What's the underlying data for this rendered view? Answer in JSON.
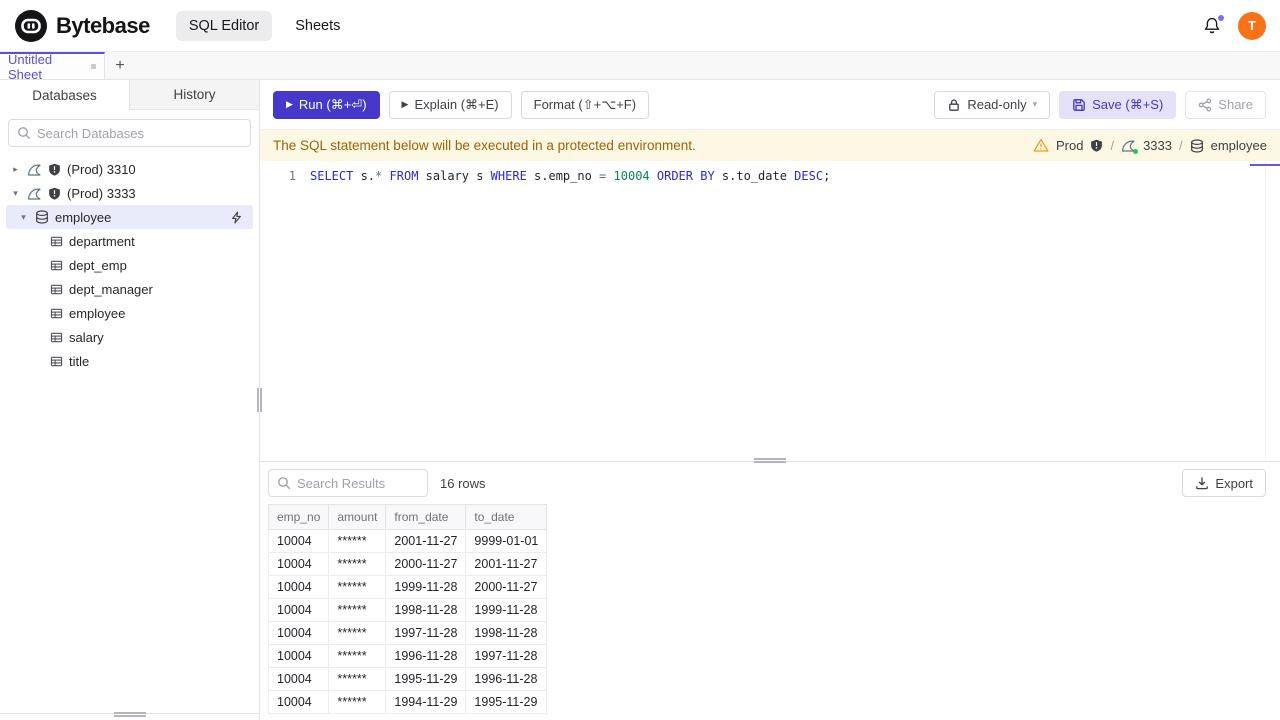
{
  "colors": {
    "accent": "#4538ca",
    "accent_light_bg": "#e4e1f9",
    "banner_bg": "#fcf8e3",
    "banner_text": "#a16207",
    "avatar_bg": "#f97316",
    "notification_dot": "#7a6ff0",
    "connection_status_dot": "#22c55e",
    "sql_keyword": "#2a2ad4",
    "sql_number": "#098658",
    "selected_tree_row_bg": "#e9ebfa"
  },
  "header": {
    "brand": "Bytebase",
    "nav_sql_editor": "SQL Editor",
    "nav_sheets": "Sheets",
    "avatar_initial": "T"
  },
  "sheetbar": {
    "active_tab": "Untitled Sheet",
    "add_button": "+"
  },
  "sidebar": {
    "tab_databases": "Databases",
    "tab_history": "History",
    "search_placeholder": "Search Databases",
    "instances": [
      {
        "label": "(Prod) 3310",
        "expanded": false
      },
      {
        "label": "(Prod) 3333",
        "expanded": true
      }
    ],
    "database": "employee",
    "tables": [
      "department",
      "dept_emp",
      "dept_manager",
      "employee",
      "salary",
      "title"
    ],
    "caret_collapsed": "▸",
    "caret_expanded": "▾"
  },
  "toolbar": {
    "run": "Run (⌘+⏎)",
    "explain": "Explain (⌘+E)",
    "format": "Format (⇧+⌥+F)",
    "readonly": "Read-only",
    "save": "Save (⌘+S)",
    "share": "Share",
    "play_glyph": "▶",
    "chevron_glyph": "▾"
  },
  "banner": {
    "message": "The SQL statement below will be executed in a protected environment.",
    "environment": "Prod",
    "separator": "/",
    "instance": "3333",
    "database": "employee"
  },
  "editor": {
    "line_number": "1",
    "sql_text": "SELECT s.* FROM salary s WHERE s.emp_no = 10004 ORDER BY s.to_date DESC;",
    "tokens": [
      {
        "text": "SELECT",
        "type": "keyword"
      },
      {
        "text": " s.",
        "type": "plain"
      },
      {
        "text": "*",
        "type": "operator"
      },
      {
        "text": " ",
        "type": "plain"
      },
      {
        "text": "FROM",
        "type": "keyword"
      },
      {
        "text": " salary s ",
        "type": "plain"
      },
      {
        "text": "WHERE",
        "type": "keyword"
      },
      {
        "text": " s.emp_no ",
        "type": "plain"
      },
      {
        "text": "=",
        "type": "operator"
      },
      {
        "text": " ",
        "type": "plain"
      },
      {
        "text": "10004",
        "type": "number"
      },
      {
        "text": " ",
        "type": "plain"
      },
      {
        "text": "ORDER",
        "type": "keyword"
      },
      {
        "text": " ",
        "type": "plain"
      },
      {
        "text": "BY",
        "type": "keyword"
      },
      {
        "text": " s.to_date ",
        "type": "plain"
      },
      {
        "text": "DESC",
        "type": "keyword"
      },
      {
        "text": ";",
        "type": "plain"
      }
    ]
  },
  "results": {
    "search_placeholder": "Search Results",
    "row_count": "16 rows",
    "export": "Export",
    "columns": [
      "emp_no",
      "amount",
      "from_date",
      "to_date"
    ],
    "rows": [
      [
        "10004",
        "******",
        "2001-11-27",
        "9999-01-01"
      ],
      [
        "10004",
        "******",
        "2000-11-27",
        "2001-11-27"
      ],
      [
        "10004",
        "******",
        "1999-11-28",
        "2000-11-27"
      ],
      [
        "10004",
        "******",
        "1998-11-28",
        "1999-11-28"
      ],
      [
        "10004",
        "******",
        "1997-11-28",
        "1998-11-28"
      ],
      [
        "10004",
        "******",
        "1996-11-28",
        "1997-11-28"
      ],
      [
        "10004",
        "******",
        "1995-11-29",
        "1996-11-28"
      ],
      [
        "10004",
        "******",
        "1994-11-29",
        "1995-11-29"
      ]
    ]
  }
}
